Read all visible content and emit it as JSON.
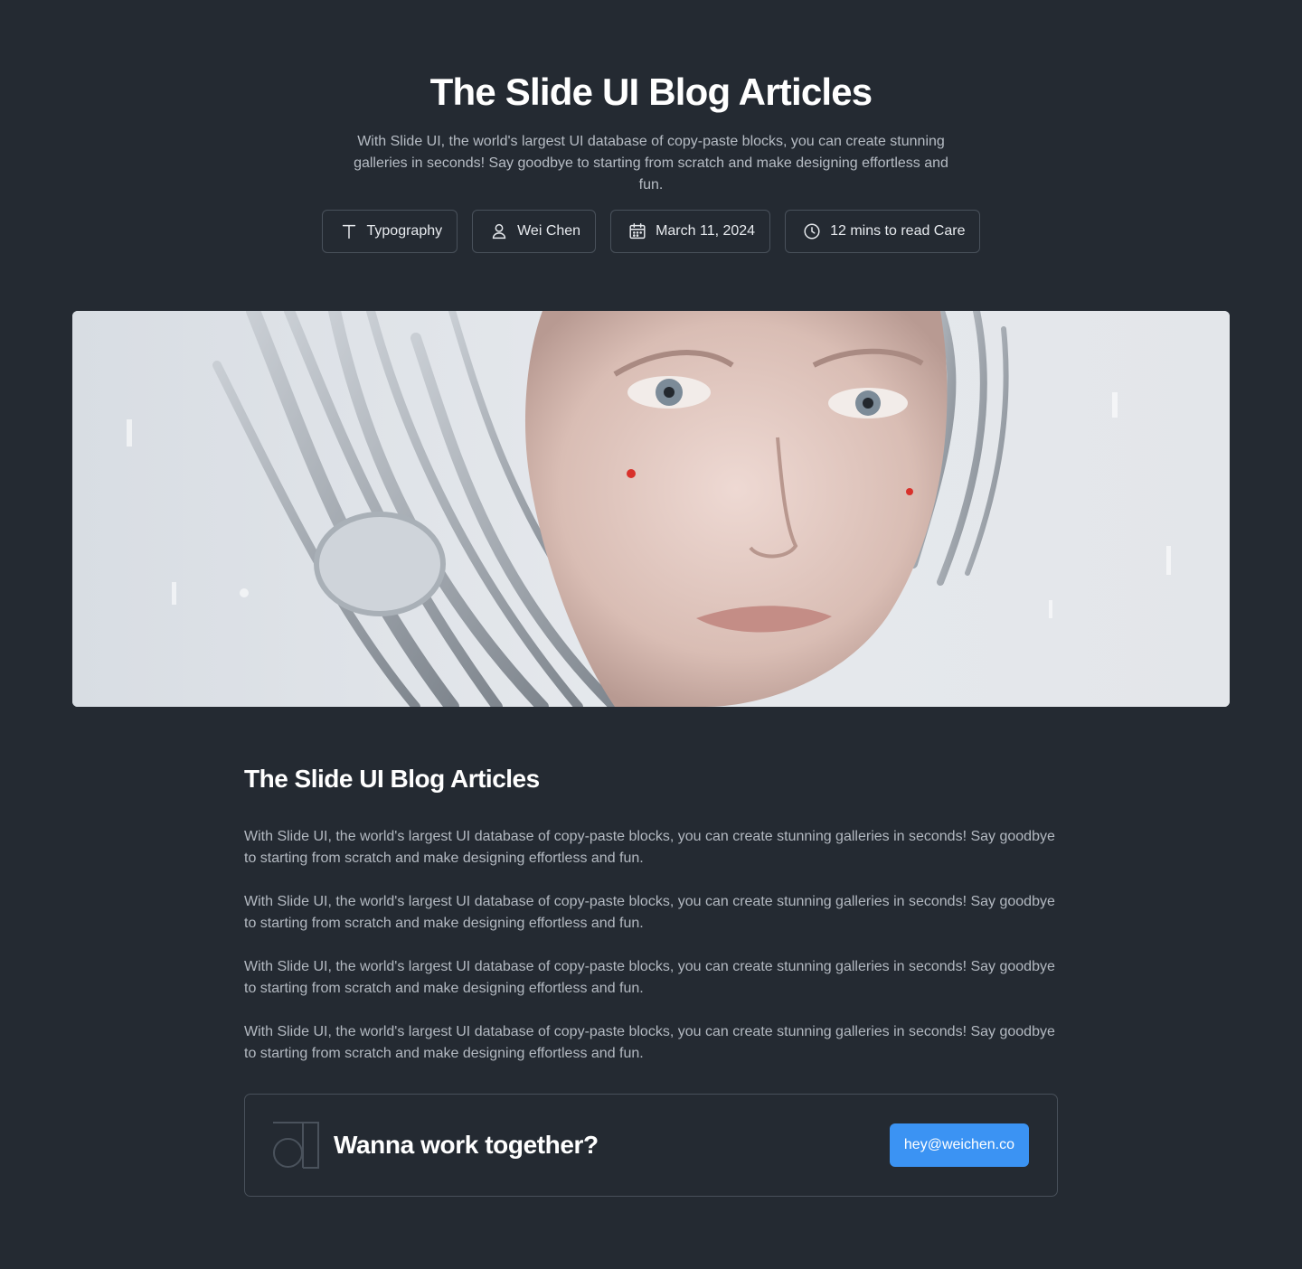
{
  "hero": {
    "title": "The Slide UI Blog Articles",
    "description": "With Slide UI, the world's largest UI database of copy-paste blocks, you can create stunning galleries in seconds! Say goodbye to starting from scratch and make designing effortless and fun."
  },
  "tags": [
    {
      "label": "Typography",
      "icon": "typography-icon"
    },
    {
      "label": "Wei Chen",
      "icon": "user-icon"
    },
    {
      "label": "March 11, 2024",
      "icon": "calendar-icon"
    },
    {
      "label": "12 mins to read Care",
      "icon": "clock-icon"
    }
  ],
  "banner": {
    "alt": "robot-woman-portrait"
  },
  "article": {
    "title": "The Slide UI Blog Articles",
    "paragraphs": [
      "With Slide UI, the world's largest UI database of copy-paste blocks, you can create stunning galleries in seconds! Say goodbye to starting from scratch and make designing effortless and fun.",
      "With Slide UI, the world's largest UI database of copy-paste blocks, you can create stunning galleries in seconds! Say goodbye to starting from scratch and make designing effortless and fun.",
      "With Slide UI, the world's largest UI database of copy-paste blocks, you can create stunning galleries in seconds! Say goodbye to starting from scratch and make designing effortless and fun.",
      "With Slide UI, the world's largest UI database of copy-paste blocks, you can create stunning galleries in seconds! Say goodbye to starting from scratch and make designing effortless and fun."
    ]
  },
  "cta": {
    "title": "Wanna work together?",
    "button_label": "hey@weichen.co"
  },
  "colors": {
    "background": "#242a32",
    "accent": "#3b93f3",
    "border": "#49515b"
  }
}
